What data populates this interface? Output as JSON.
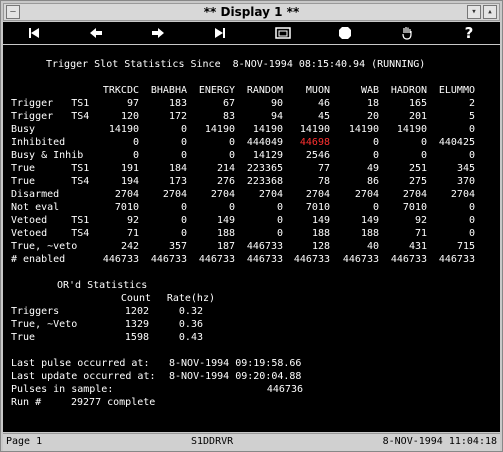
{
  "window": {
    "title": "** Display 1 **"
  },
  "toolbar": {
    "buttons": [
      "first-page-icon",
      "prev-page-icon",
      "next-page-icon",
      "last-page-icon",
      "window-icon",
      "stop-icon",
      "hand-icon",
      "help-icon"
    ],
    "help_label": "?"
  },
  "screen": {
    "heading": "Trigger Slot Statistics Since  8-NOV-1994 08:15:40.94 (RUNNING)",
    "columns": [
      "TRKCDC",
      "BHABHA",
      "ENERGY",
      "RANDOM",
      "MUON",
      "WAB",
      "HADRON",
      "ELUMMO"
    ],
    "rows": [
      {
        "label": "Trigger   TS1",
        "values": [
          "97",
          "183",
          "67",
          "90",
          "46",
          "18",
          "165",
          "2"
        ]
      },
      {
        "label": "Trigger   TS4",
        "values": [
          "120",
          "172",
          "83",
          "94",
          "45",
          "20",
          "201",
          "5"
        ]
      },
      {
        "label": "Busy",
        "values": [
          "14190",
          "0",
          "14190",
          "14190",
          "14190",
          "14190",
          "14190",
          "0"
        ]
      },
      {
        "label": "Inhibited",
        "values": [
          "0",
          "0",
          "0",
          "444049",
          "44698",
          "0",
          "0",
          "440425"
        ]
      },
      {
        "label": "Busy & Inhib",
        "values": [
          "0",
          "0",
          "0",
          "14129",
          "2546",
          "0",
          "0",
          "0"
        ]
      },
      {
        "label": "True      TS1",
        "values": [
          "191",
          "184",
          "214",
          "223365",
          "77",
          "49",
          "251",
          "345"
        ]
      },
      {
        "label": "True      TS4",
        "values": [
          "194",
          "173",
          "276",
          "223368",
          "78",
          "86",
          "275",
          "370"
        ]
      },
      {
        "label": "Disarmed",
        "values": [
          "2704",
          "2704",
          "2704",
          "2704",
          "2704",
          "2704",
          "2704",
          "2704"
        ]
      },
      {
        "label": "Not eval",
        "values": [
          "7010",
          "0",
          "0",
          "0",
          "7010",
          "0",
          "7010",
          "0"
        ]
      },
      {
        "label": "Vetoed    TS1",
        "values": [
          "92",
          "0",
          "149",
          "0",
          "149",
          "149",
          "92",
          "0"
        ]
      },
      {
        "label": "Vetoed    TS4",
        "values": [
          "71",
          "0",
          "188",
          "0",
          "188",
          "188",
          "71",
          "0"
        ]
      },
      {
        "label": "True, ~veto",
        "values": [
          "242",
          "357",
          "187",
          "446733",
          "128",
          "40",
          "431",
          "715"
        ]
      },
      {
        "label": "# enabled",
        "values": [
          "446733",
          "446733",
          "446733",
          "446733",
          "446733",
          "446733",
          "446733",
          "446733"
        ]
      }
    ],
    "highlight_color": "#ff3030",
    "or_heading": "OR'd Statistics",
    "or_columns": [
      "Count",
      "Rate(hz)"
    ],
    "or_rows": [
      {
        "label": "Triggers",
        "count": "1202",
        "rate": "0.32"
      },
      {
        "label": "True, ~Veto",
        "count": "1329",
        "rate": "0.36"
      },
      {
        "label": "True",
        "count": "1598",
        "rate": "0.43"
      }
    ],
    "last_pulse_label": "Last pulse occurred at:",
    "last_pulse_value": "8-NOV-1994 09:19:58.66",
    "last_update_label": "Last update occurred at:",
    "last_update_value": "8-NOV-1994 09:20:04.88",
    "pulses_label": "Pulses in sample:",
    "pulses_value": "446736",
    "run_label": "Run #",
    "run_value": "29277 complete"
  },
  "status": {
    "page": "Page 1",
    "node": "S1DDRVR",
    "datetime": "8-NOV-1994 11:04:18"
  }
}
